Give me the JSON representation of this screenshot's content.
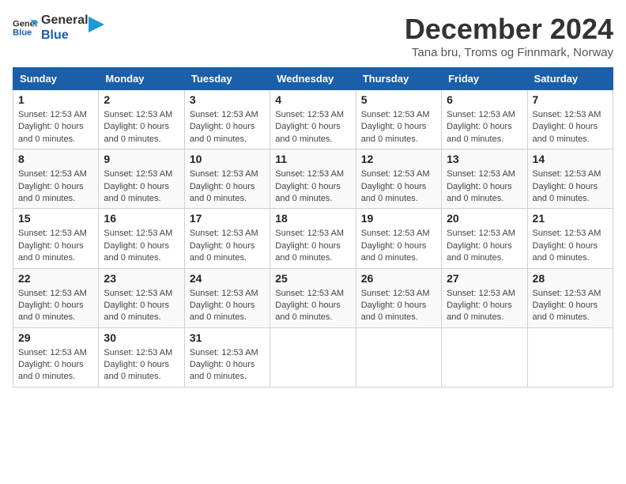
{
  "logo": {
    "line1": "General",
    "line2": "Blue"
  },
  "title": "December 2024",
  "subtitle": "Tana bru, Troms og Finnmark, Norway",
  "days_of_week": [
    "Sunday",
    "Monday",
    "Tuesday",
    "Wednesday",
    "Thursday",
    "Friday",
    "Saturday"
  ],
  "day_info_text": "Sunset: 12:53 AM\nDaylight: 0 hours and 0 minutes.",
  "weeks": [
    [
      {
        "day": "1",
        "info": "Sunset: 12:53 AM\nDaylight: 0 hours\nand 0 minutes."
      },
      {
        "day": "2",
        "info": "Sunset: 12:53 AM\nDaylight: 0 hours\nand 0 minutes."
      },
      {
        "day": "3",
        "info": "Sunset: 12:53 AM\nDaylight: 0 hours\nand 0 minutes."
      },
      {
        "day": "4",
        "info": "Sunset: 12:53 AM\nDaylight: 0 hours\nand 0 minutes."
      },
      {
        "day": "5",
        "info": "Sunset: 12:53 AM\nDaylight: 0 hours\nand 0 minutes."
      },
      {
        "day": "6",
        "info": "Sunset: 12:53 AM\nDaylight: 0 hours\nand 0 minutes."
      },
      {
        "day": "7",
        "info": "Sunset: 12:53 AM\nDaylight: 0 hours\nand 0 minutes."
      }
    ],
    [
      {
        "day": "8",
        "info": "Sunset: 12:53 AM\nDaylight: 0 hours\nand 0 minutes."
      },
      {
        "day": "9",
        "info": "Sunset: 12:53 AM\nDaylight: 0 hours\nand 0 minutes."
      },
      {
        "day": "10",
        "info": "Sunset: 12:53 AM\nDaylight: 0 hours\nand 0 minutes."
      },
      {
        "day": "11",
        "info": "Sunset: 12:53 AM\nDaylight: 0 hours\nand 0 minutes."
      },
      {
        "day": "12",
        "info": "Sunset: 12:53 AM\nDaylight: 0 hours\nand 0 minutes."
      },
      {
        "day": "13",
        "info": "Sunset: 12:53 AM\nDaylight: 0 hours\nand 0 minutes."
      },
      {
        "day": "14",
        "info": "Sunset: 12:53 AM\nDaylight: 0 hours\nand 0 minutes."
      }
    ],
    [
      {
        "day": "15",
        "info": "Sunset: 12:53 AM\nDaylight: 0 hours\nand 0 minutes."
      },
      {
        "day": "16",
        "info": "Sunset: 12:53 AM\nDaylight: 0 hours\nand 0 minutes."
      },
      {
        "day": "17",
        "info": "Sunset: 12:53 AM\nDaylight: 0 hours\nand 0 minutes."
      },
      {
        "day": "18",
        "info": "Sunset: 12:53 AM\nDaylight: 0 hours\nand 0 minutes."
      },
      {
        "day": "19",
        "info": "Sunset: 12:53 AM\nDaylight: 0 hours\nand 0 minutes."
      },
      {
        "day": "20",
        "info": "Sunset: 12:53 AM\nDaylight: 0 hours\nand 0 minutes."
      },
      {
        "day": "21",
        "info": "Sunset: 12:53 AM\nDaylight: 0 hours\nand 0 minutes."
      }
    ],
    [
      {
        "day": "22",
        "info": "Sunset: 12:53 AM\nDaylight: 0 hours\nand 0 minutes."
      },
      {
        "day": "23",
        "info": "Sunset: 12:53 AM\nDaylight: 0 hours\nand 0 minutes."
      },
      {
        "day": "24",
        "info": "Sunset: 12:53 AM\nDaylight: 0 hours\nand 0 minutes."
      },
      {
        "day": "25",
        "info": "Sunset: 12:53 AM\nDaylight: 0 hours\nand 0 minutes."
      },
      {
        "day": "26",
        "info": "Sunset: 12:53 AM\nDaylight: 0 hours\nand 0 minutes."
      },
      {
        "day": "27",
        "info": "Sunset: 12:53 AM\nDaylight: 0 hours\nand 0 minutes."
      },
      {
        "day": "28",
        "info": "Sunset: 12:53 AM\nDaylight: 0 hours\nand 0 minutes."
      }
    ],
    [
      {
        "day": "29",
        "info": "Sunset: 12:53 AM\nDaylight: 0 hours\nand 0 minutes."
      },
      {
        "day": "30",
        "info": "Sunset: 12:53 AM\nDaylight: 0 hours\nand 0 minutes."
      },
      {
        "day": "31",
        "info": "Sunset: 12:53 AM\nDaylight: 0 hours\nand 0 minutes."
      },
      {
        "day": "",
        "info": ""
      },
      {
        "day": "",
        "info": ""
      },
      {
        "day": "",
        "info": ""
      },
      {
        "day": "",
        "info": ""
      }
    ]
  ]
}
